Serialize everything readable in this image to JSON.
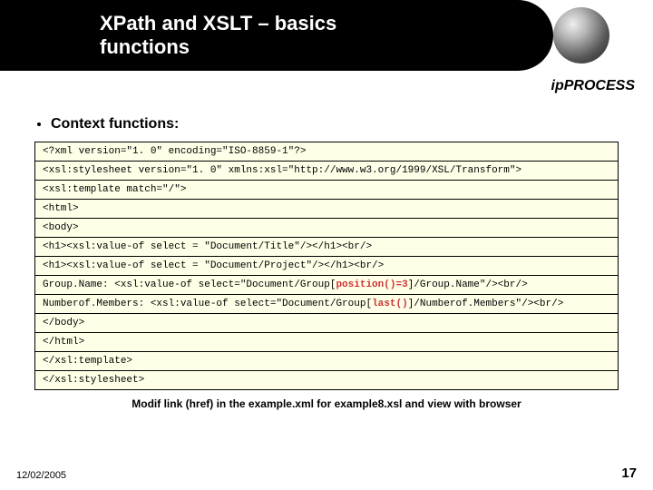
{
  "header": {
    "title_line1": "XPath and XSLT – basics",
    "title_line2": "functions"
  },
  "logo": {
    "text": "ipPROCESS"
  },
  "section": {
    "title": "Context functions:"
  },
  "code": {
    "r1": "<?xml version=\"1. 0\" encoding=\"ISO-8859-1\"?>",
    "r2": "<xsl:stylesheet version=\"1. 0\" xmlns:xsl=\"http://www.w3.org/1999/XSL/Transform\">",
    "r3": "<xsl:template match=\"/\">",
    "r4": "<html>",
    "r5": "<body>",
    "r6": "<h1><xsl:value-of select = \"Document/Title\"/></h1><br/>",
    "r7": "<h1><xsl:value-of select = \"Document/Project\"/></h1><br/>",
    "r8a": "Group.Name: <xsl:value-of select=\"Document/Group[",
    "r8h": "position()=3",
    "r8b": "]/Group.Name\"/><br/>",
    "r9a": "Numberof.Members: <xsl:value-of select=\"Document/Group[",
    "r9h": "last()",
    "r9b": "]/Numberof.Members\"/><br/>",
    "r10": "</body>",
    "r11": "</html>",
    "r12": "</xsl:template>",
    "r13": "</xsl:stylesheet>"
  },
  "footer": {
    "note": "Modif link (href) in the example.xml for example8.xsl and view with browser",
    "date": "12/02/2005",
    "page": "17"
  }
}
